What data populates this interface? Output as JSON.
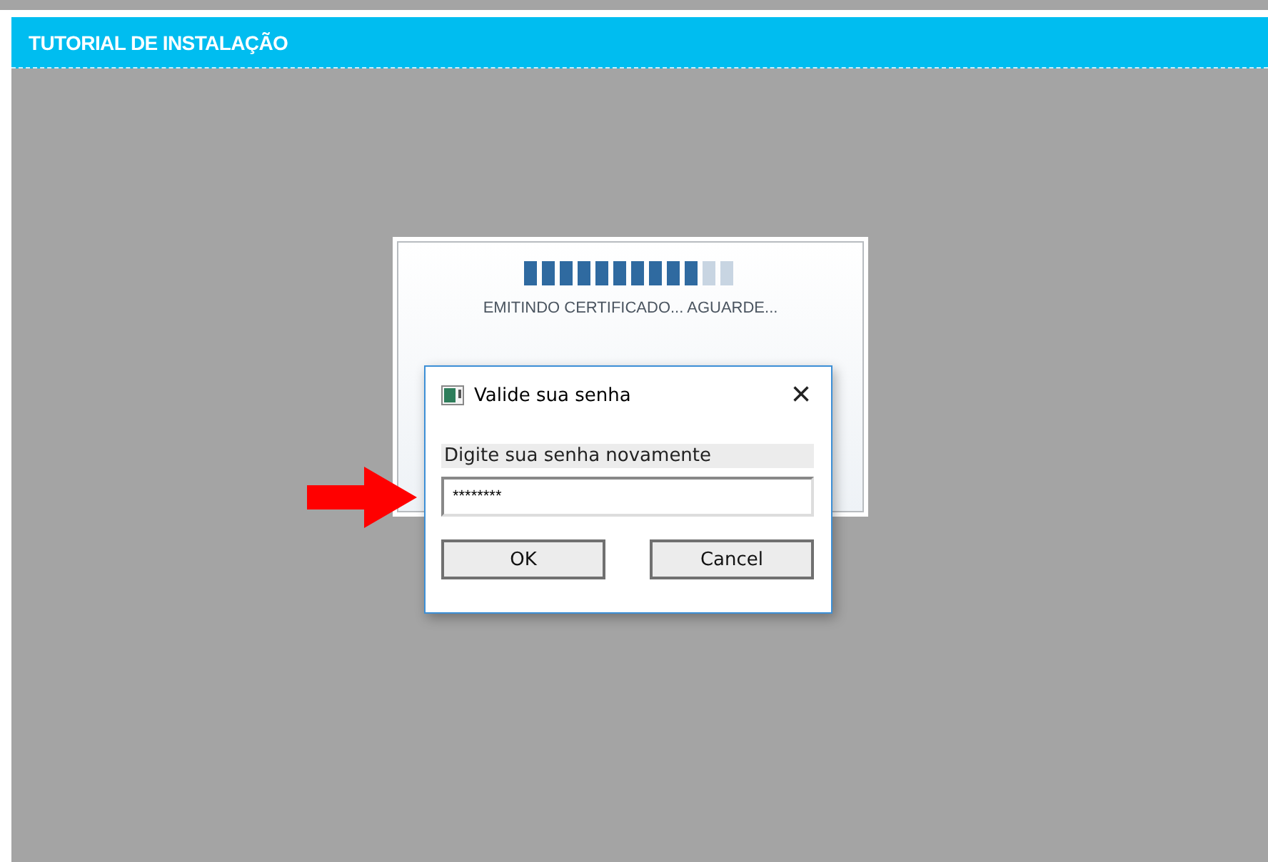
{
  "header": {
    "title": "TUTORIAL DE INSTALAÇÃO"
  },
  "loading": {
    "level": 0.833,
    "message": "EMITINDO CERTIFICADO... AGUARDE..."
  },
  "dialog": {
    "title": "Valide sua senha",
    "close": "×",
    "prompt": "Digite sua senha novamente",
    "password": {
      "value": "********"
    },
    "buttons": [
      {
        "label": "OK"
      },
      {
        "label": "Cancel"
      }
    ]
  }
}
